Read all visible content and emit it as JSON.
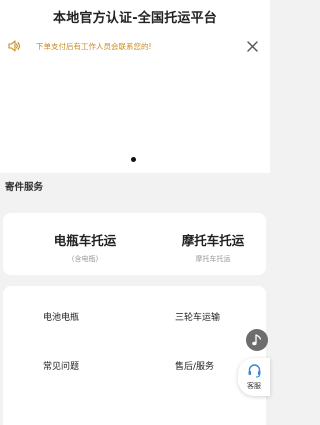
{
  "header": {
    "title": "本地官方认证-全国托运平台"
  },
  "notice": {
    "text": "下单支付后有工作人员会联系您的!",
    "icon": "speaker-icon",
    "close_icon": "close-icon",
    "text_color": "#c98a1f"
  },
  "banner": {
    "page_indicator_count": 1
  },
  "section": {
    "title": "寄件服务"
  },
  "services": [
    {
      "name": "电瓶车托运",
      "sub": "(含电瓶)"
    },
    {
      "name": "摩托车托运",
      "sub": "摩托车托运"
    }
  ],
  "menu": [
    "电池电瓶",
    "三轮车运输",
    "常见问题",
    "售后/服务"
  ],
  "floating": {
    "music_icon": "music-note-icon",
    "support_icon": "headset-icon",
    "support_label": "客服"
  }
}
